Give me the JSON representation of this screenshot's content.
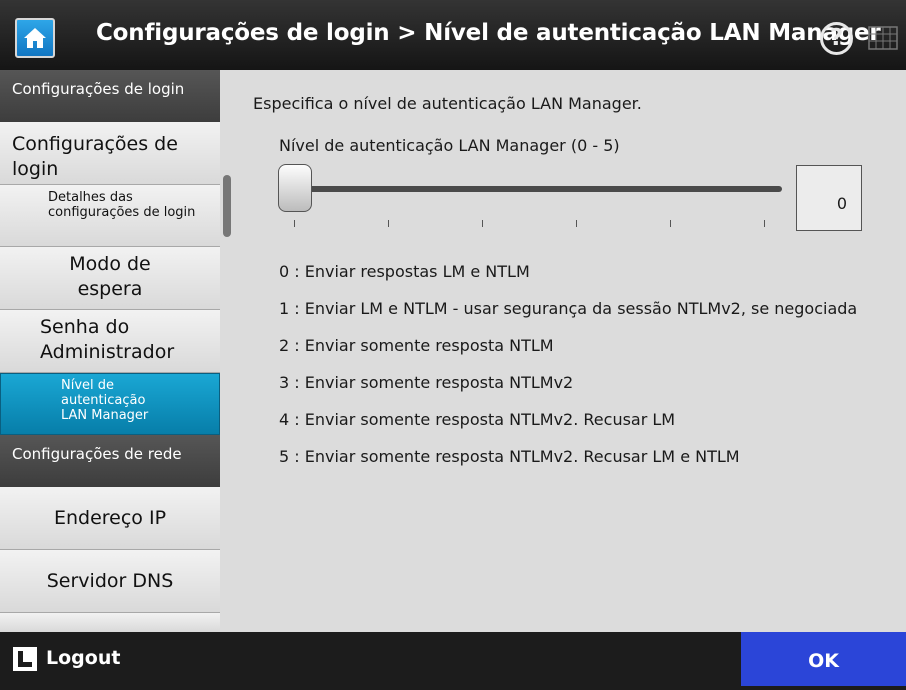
{
  "header": {
    "title": "Configurações de login > Nível de autenticação LAN Manager",
    "help_label": "?",
    "icons": {
      "home": "home-icon",
      "help": "help-icon",
      "keyboard": "keyboard-icon"
    }
  },
  "sidebar": {
    "items": [
      {
        "label": "Configurações de login",
        "type": "category"
      },
      {
        "label": "Configurações de login",
        "type": "item"
      },
      {
        "label": "Detalhes das configurações de login",
        "type": "subitem"
      },
      {
        "label": "Modo de espera",
        "type": "item"
      },
      {
        "label": "Senha do Administrador",
        "type": "item"
      },
      {
        "label": "Nível de autenticação LAN Manager",
        "type": "subitem",
        "selected": true
      },
      {
        "label": "Configurações de rede",
        "type": "category"
      },
      {
        "label": "Endereço IP",
        "type": "item"
      },
      {
        "label": "Servidor DNS",
        "type": "item"
      }
    ]
  },
  "main": {
    "description": "Especifica o nível de autenticação LAN Manager.",
    "slider": {
      "label": "Nível de autenticação LAN Manager (0 - 5)",
      "min": 0,
      "max": 5,
      "value": 0,
      "display_value": "0"
    },
    "levels": [
      "0 : Enviar respostas LM e NTLM",
      "1 : Enviar LM e NTLM - usar segurança da sessão NTLMv2, se negociada",
      "2 : Enviar somente resposta NTLM",
      "3 : Enviar somente resposta NTLMv2",
      "4 : Enviar somente resposta NTLMv2. Recusar LM",
      "5 : Enviar somente resposta NTLMv2. Recusar LM e NTLM"
    ]
  },
  "footer": {
    "logout_label": "Logout",
    "ok_label": "OK"
  },
  "colors": {
    "accent": "#2b45d8",
    "selected": "#0a8fbf",
    "home": "#1a8fd8"
  }
}
